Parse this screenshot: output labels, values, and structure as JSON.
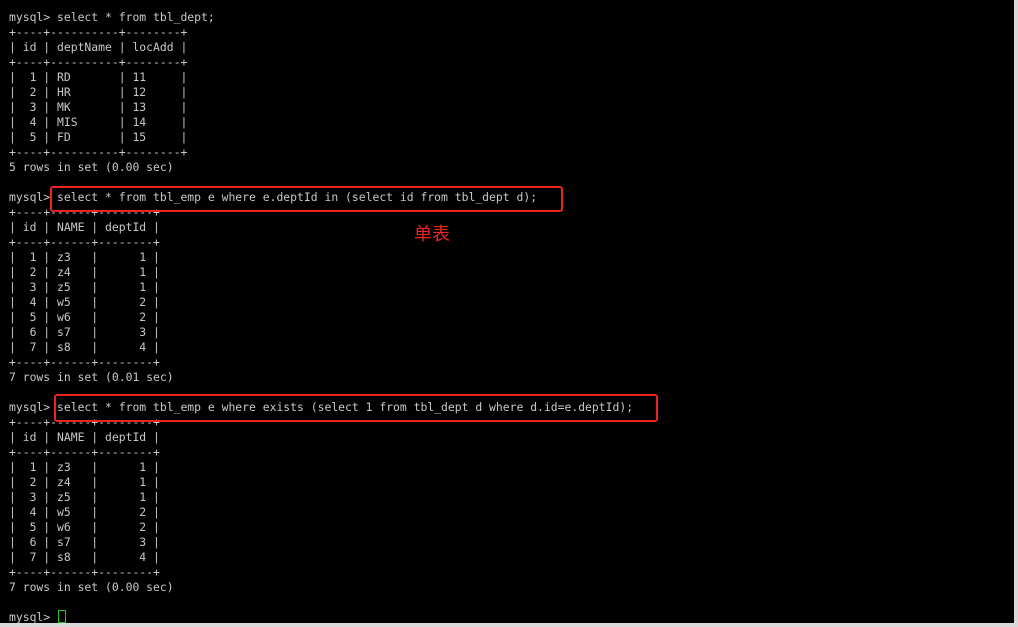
{
  "terminal": {
    "lines": [
      "mysql> select * from tbl_dept;",
      "+----+----------+--------+",
      "| id | deptName | locAdd |",
      "+----+----------+--------+",
      "|  1 | RD       | 11     |",
      "|  2 | HR       | 12     |",
      "|  3 | MK       | 13     |",
      "|  4 | MIS      | 14     |",
      "|  5 | FD       | 15     |",
      "+----+----------+--------+",
      "5 rows in set (0.00 sec)",
      "",
      "mysql> select * from tbl_emp e where e.deptId in (select id from tbl_dept d);",
      "+----+------+--------+",
      "| id | NAME | deptId |",
      "+----+------+--------+",
      "|  1 | z3   |      1 |",
      "|  2 | z4   |      1 |",
      "|  3 | z5   |      1 |",
      "|  4 | w5   |      2 |",
      "|  5 | w6   |      2 |",
      "|  6 | s7   |      3 |",
      "|  7 | s8   |      4 |",
      "+----+------+--------+",
      "7 rows in set (0.01 sec)",
      "",
      "mysql> select * from tbl_emp e where exists (select 1 from tbl_dept d where d.id=e.deptId);",
      "+----+------+--------+",
      "| id | NAME | deptId |",
      "+----+------+--------+",
      "|  1 | z3   |      1 |",
      "|  2 | z4   |      1 |",
      "|  3 | z5   |      1 |",
      "|  4 | w5   |      2 |",
      "|  5 | w6   |      2 |",
      "|  6 | s7   |      3 |",
      "|  7 | s8   |      4 |",
      "+----+------+--------+",
      "7 rows in set (0.00 sec)",
      "",
      "mysql> "
    ],
    "annotation": "单表",
    "highlight_color": "#e8251e",
    "cursor_color": "#22c322"
  }
}
